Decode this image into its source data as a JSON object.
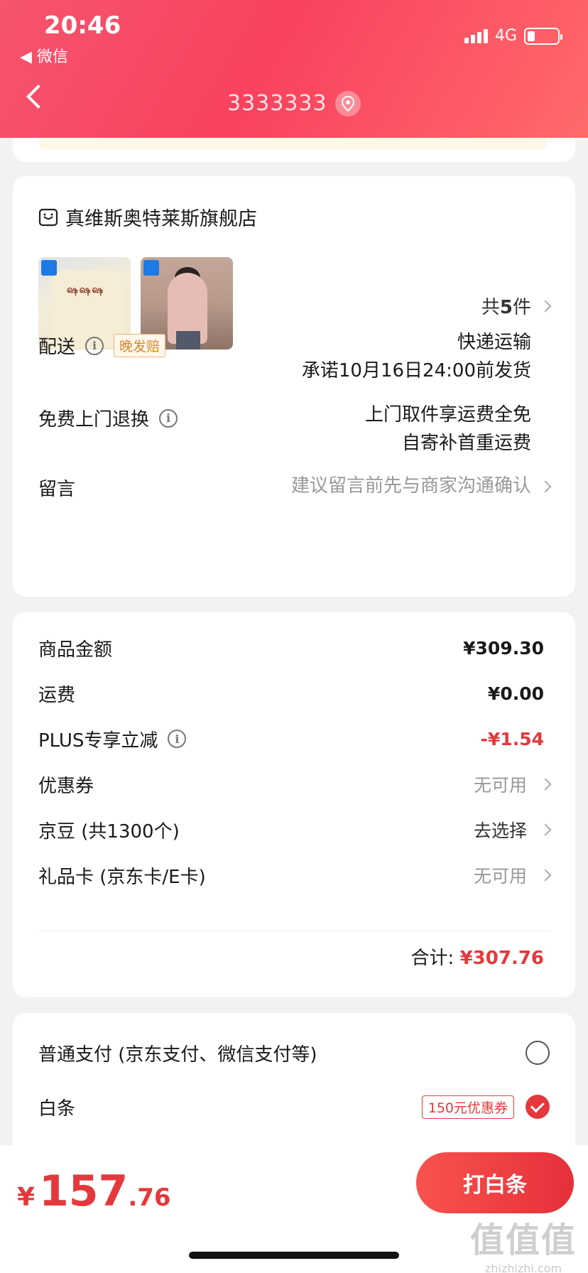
{
  "status_bar": {
    "time": "20:46",
    "back_app": "◀ 微信",
    "network": "4G",
    "battery_level": 0.25
  },
  "nav": {
    "title": "3333333",
    "location_icon": "location-pin-icon"
  },
  "shop": {
    "icon": "shop-icon",
    "name": "真维斯奥特莱斯旗舰店",
    "item_count_prefix": "共",
    "item_count": "5",
    "item_count_suffix": "件",
    "embroidery_text": "ஷஷஷ"
  },
  "delivery": {
    "label": "配送",
    "tag": "晚发赔",
    "method": "快递运输",
    "promise": "承诺10月16日24:00前发货"
  },
  "returns": {
    "label": "免费上门退换",
    "line1": "上门取件享运费全免",
    "line2": "自寄补首重运费"
  },
  "message": {
    "label": "留言",
    "placeholder": "建议留言前先与商家沟通确认"
  },
  "price": {
    "rows": [
      {
        "label": "商品金额",
        "value": "¥309.30"
      },
      {
        "label": "运费",
        "value": "¥0.00"
      },
      {
        "label": "PLUS专享立减",
        "value": "-¥1.54"
      },
      {
        "label": "优惠券",
        "value": "无可用"
      },
      {
        "label": "京豆 (共1300个)",
        "value": "去选择"
      },
      {
        "label": "礼品卡 (京东卡/E卡)",
        "value": "无可用"
      }
    ],
    "total_label": "合计:",
    "total_value": "¥307.76"
  },
  "payment": {
    "option1": "普通支付 (京东支付、微信支付等)",
    "option2": "白条",
    "option2_tag": "150元优惠券",
    "selected": "白条"
  },
  "bottom_bar": {
    "yen": "¥",
    "price_int": "157",
    "price_dec": ".76",
    "button": "打白条"
  },
  "watermark": {
    "logo": "值值值",
    "url": "zhizhizhi.com"
  },
  "colors": {
    "accent": "#e4393c",
    "header_gradient_start": "#f5546e",
    "header_gradient_end": "#ff6a6a"
  }
}
